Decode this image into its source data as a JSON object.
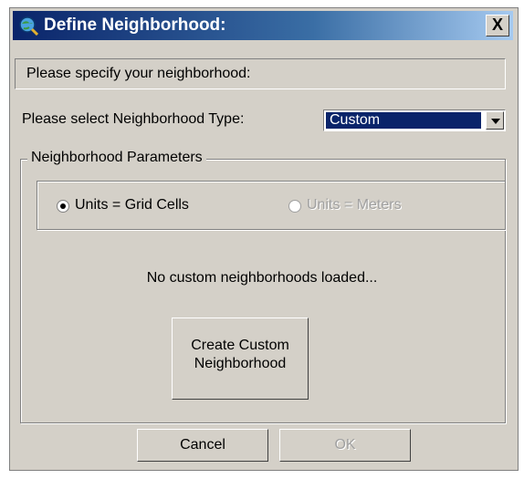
{
  "window": {
    "title": "Define Neighborhood:",
    "close_label": "X",
    "icon": "globe-magnifier-icon"
  },
  "prompt": "Please specify your neighborhood:",
  "neighborhood_type": {
    "label": "Please select Neighborhood Type:",
    "selected": "Custom"
  },
  "parameters": {
    "group_label": "Neighborhood Parameters",
    "units_options": [
      {
        "label": "Units = Grid Cells",
        "checked": true,
        "enabled": true
      },
      {
        "label": "Units = Meters",
        "checked": false,
        "enabled": false
      }
    ],
    "status": "No custom neighborhoods loaded...",
    "create_button_line1": "Create Custom",
    "create_button_line2": "Neighborhood"
  },
  "buttons": {
    "cancel": "Cancel",
    "ok": "OK"
  }
}
